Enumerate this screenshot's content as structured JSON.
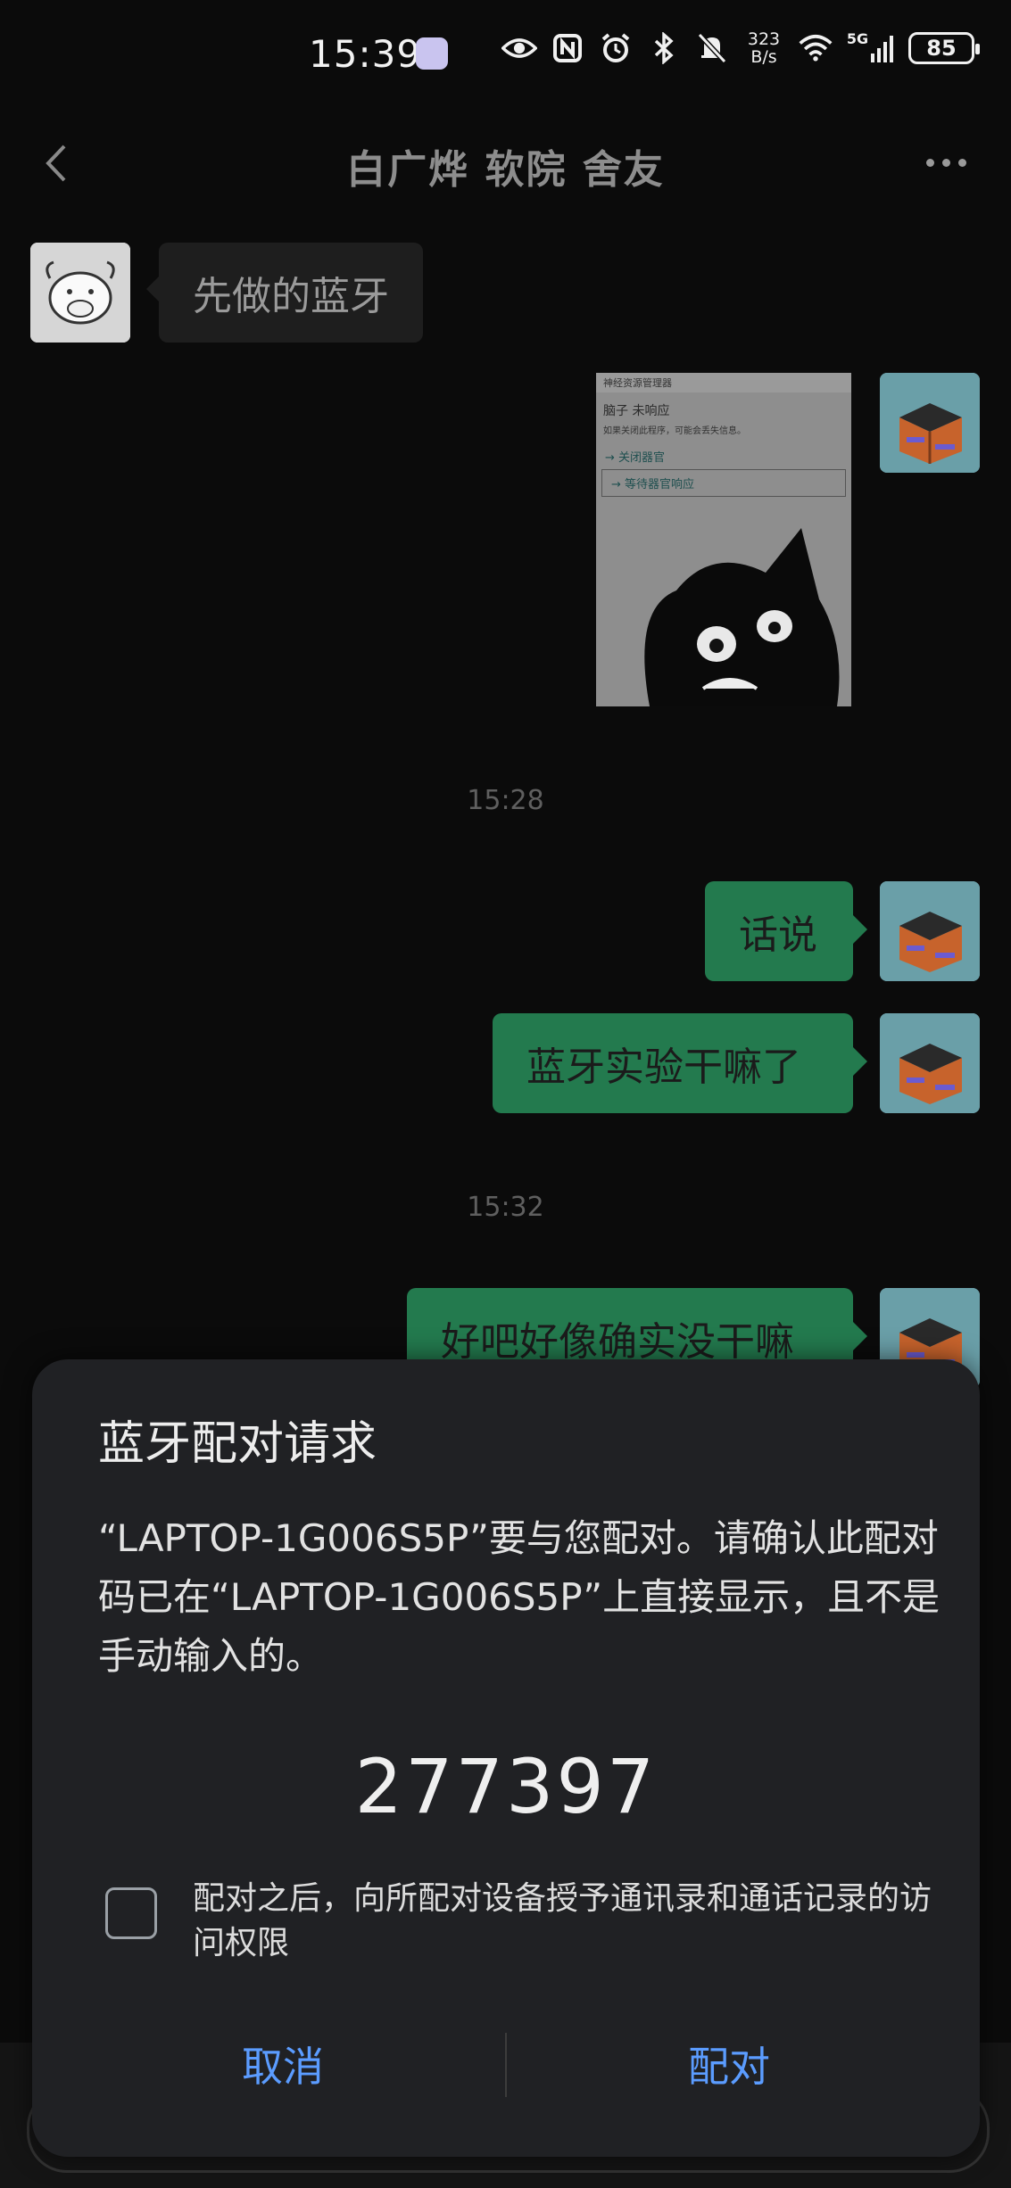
{
  "status_bar": {
    "time": "15:39",
    "net_speed_value": "323",
    "net_speed_unit": "B/s",
    "network": "5G",
    "battery": "85",
    "icons": [
      "app-notification-icon",
      "eye-icon",
      "nfc-icon",
      "alarm-icon",
      "bluetooth-icon",
      "mute-icon",
      "wifi-icon",
      "signal-icon",
      "battery-icon"
    ]
  },
  "header": {
    "title": "白广烨 软院 舍友",
    "back_icon": "chevron-left-icon",
    "more_icon": "more-dots-icon"
  },
  "chat": {
    "incoming_text": "先做的蓝牙",
    "image_message": {
      "window_title": "神经资源管理器",
      "heading": "脑子 未响应",
      "subtext": "如果关闭此程序，可能会丢失信息。",
      "option_close": "→ 关闭器官",
      "option_wait": "→ 等待器官响应"
    },
    "timestamp_1": "15:28",
    "msg_1": "话说",
    "msg_2": "蓝牙实验干嘛了",
    "timestamp_2": "15:32",
    "msg_3": "好吧好像确实没干嘛"
  },
  "dialog": {
    "title": "蓝牙配对请求",
    "message": "“LAPTOP-1G006S5P”要与您配对。请确认此配对码已在“LAPTOP-1G006S5P”上直接显示，且不是手动输入的。",
    "code": "277397",
    "checkbox_label": "配对之后，向所配对设备授予通讯录和通话记录的访问权限",
    "checkbox_checked": false,
    "cancel_label": "取消",
    "pair_label": "配对",
    "accent_color": "#5b9cff"
  }
}
